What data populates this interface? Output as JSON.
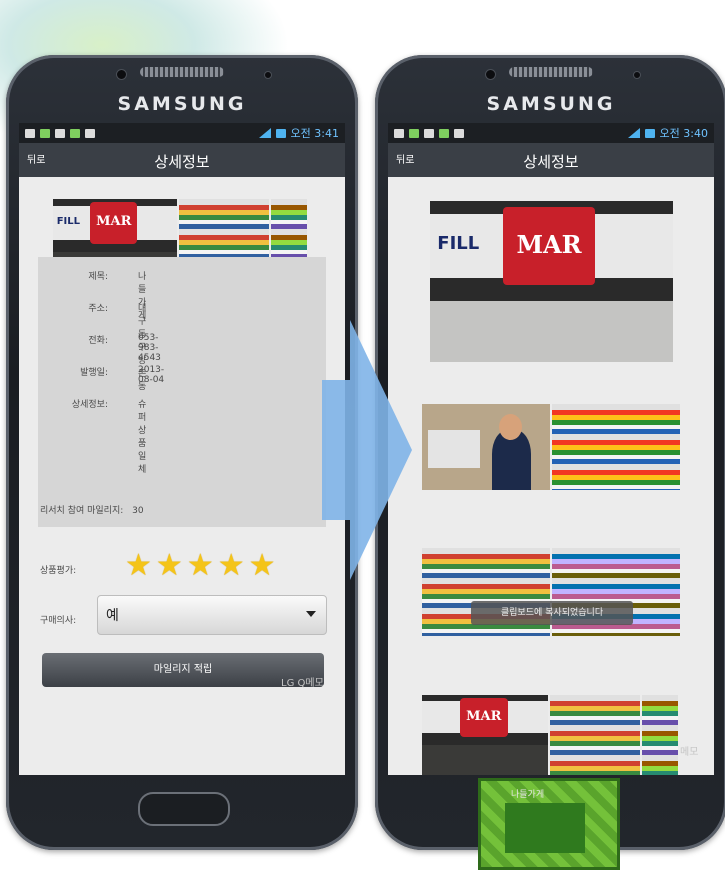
{
  "left_phone": {
    "brand": "SAMSUNG",
    "status_time": "오전 3:41",
    "nav": {
      "back_label": "뒤로",
      "title": "상세정보"
    },
    "details": [
      {
        "label": "제목:",
        "value": "나들가게"
      },
      {
        "label": "주소:",
        "value": "대구 동구 방촌동"
      },
      {
        "label": "전화:",
        "value": "053-983-4543"
      },
      {
        "label": "발행일:",
        "value": "2013-08-04"
      },
      {
        "label": "상세정보:",
        "value": "슈퍼 상품 일체"
      }
    ],
    "mileage": {
      "label": "리서치 참여 마일리지:",
      "value": "30"
    },
    "rating": {
      "label": "상품평가:",
      "stars": 5,
      "max": 5
    },
    "purchase": {
      "label": "구매의사:",
      "selected": "예"
    },
    "submit_label": "마일리지 적립",
    "watermark": "LG Q메모"
  },
  "right_phone": {
    "brand": "SAMSUNG",
    "status_time": "오전 3:40",
    "nav": {
      "back_label": "뒤로",
      "title": "상세정보"
    },
    "toast": "클립보드에 복사되었습니다",
    "watermark": "메모"
  },
  "store_sign_text": {
    "fill": "FILL",
    "mart": "MAR"
  },
  "graphic_label": "나들가게",
  "colors": {
    "accent": "#4fb3f0",
    "star": "#f4c419",
    "arrow": "#7fb4e8"
  }
}
